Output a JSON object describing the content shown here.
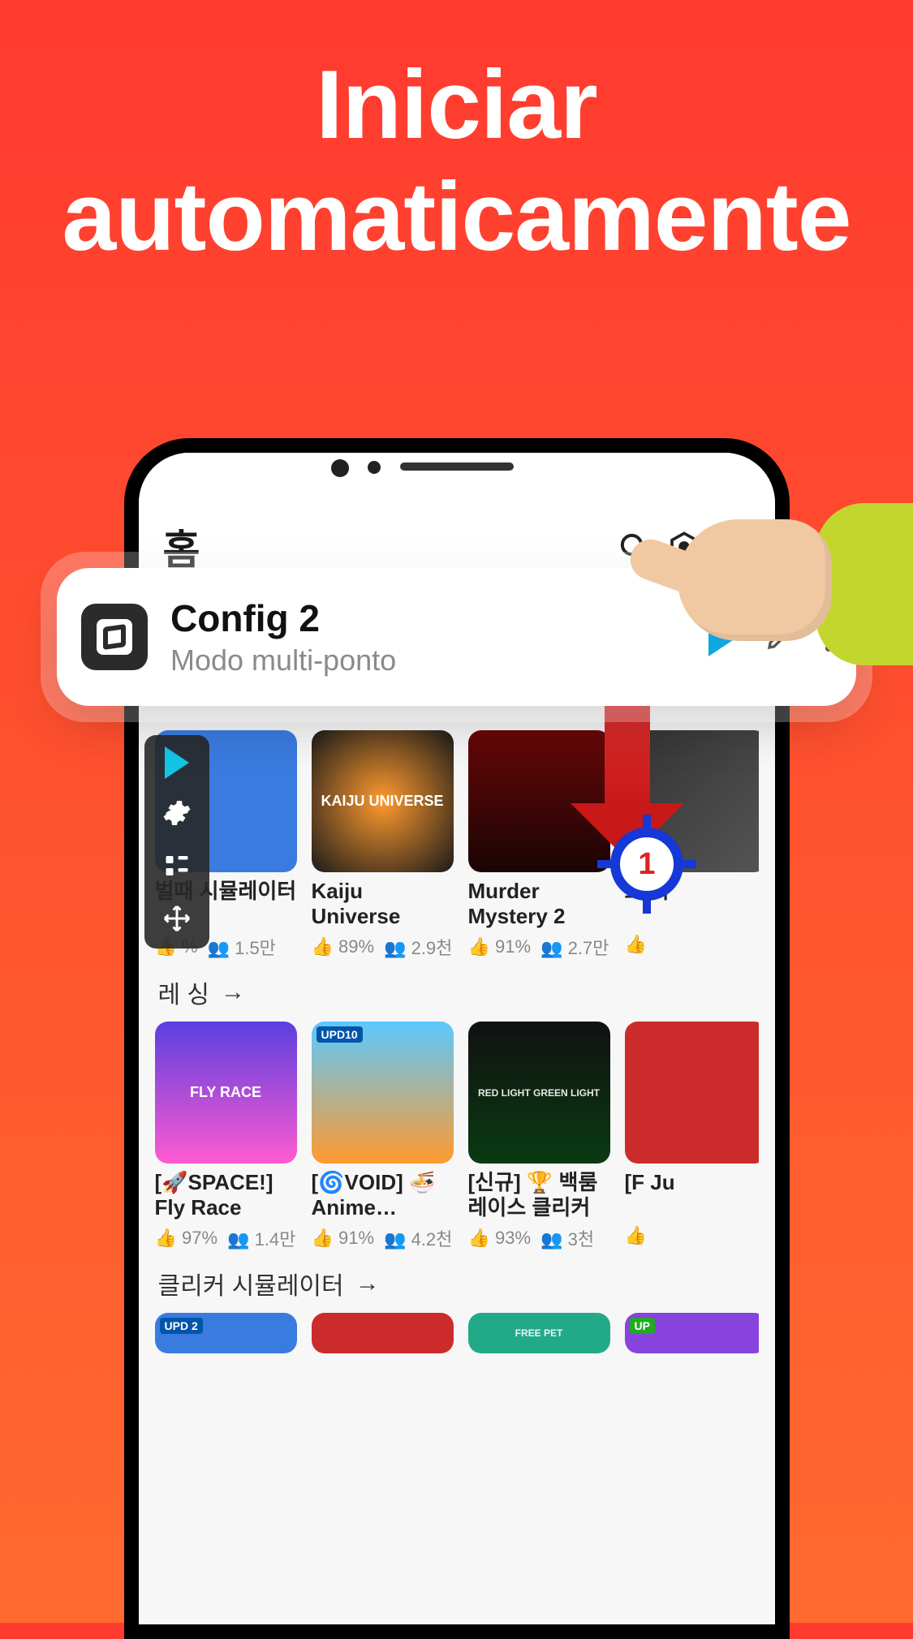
{
  "hero": {
    "title": "Iniciar automaticamente"
  },
  "header": {
    "title": "홈"
  },
  "config": {
    "title": "Config 2",
    "subtitle": "Modo multi-ponto"
  },
  "target": {
    "number": "1"
  },
  "row1": [
    {
      "title": "벌때 시뮬레이터",
      "like": "%",
      "players": "1.5만",
      "thumb": ""
    },
    {
      "title": "Kaiju Universe",
      "like": "89%",
      "players": "2.9천",
      "thumb": "KAIJU UNIVERSE"
    },
    {
      "title": "Murder Mystery 2",
      "like": "91%",
      "players": "2.7만",
      "thumb": ""
    },
    {
      "title": "보 시",
      "like": "",
      "players": "",
      "thumb": ""
    }
  ],
  "section1_label": "레  싱",
  "row2": [
    {
      "title": "[🚀SPACE!] Fly Race",
      "like": "97%",
      "players": "1.4만",
      "thumb": "FLY RACE",
      "badge": ""
    },
    {
      "title": "[🌀VOID] 🍜 Anime…",
      "like": "91%",
      "players": "4.2천",
      "thumb": "",
      "badge": "UPD10"
    },
    {
      "title": "[신규] 🏆 백룸 레이스 클리커",
      "like": "93%",
      "players": "3천",
      "thumb": "RED LIGHT GREEN LIGHT",
      "badge": ""
    },
    {
      "title": "[F Ju",
      "like": "",
      "players": "",
      "thumb": "",
      "badge": ""
    }
  ],
  "section2_label": "클리커 시뮬레이터",
  "row3_badges": [
    "UPD 2",
    "",
    "FREE PET",
    "UP"
  ]
}
